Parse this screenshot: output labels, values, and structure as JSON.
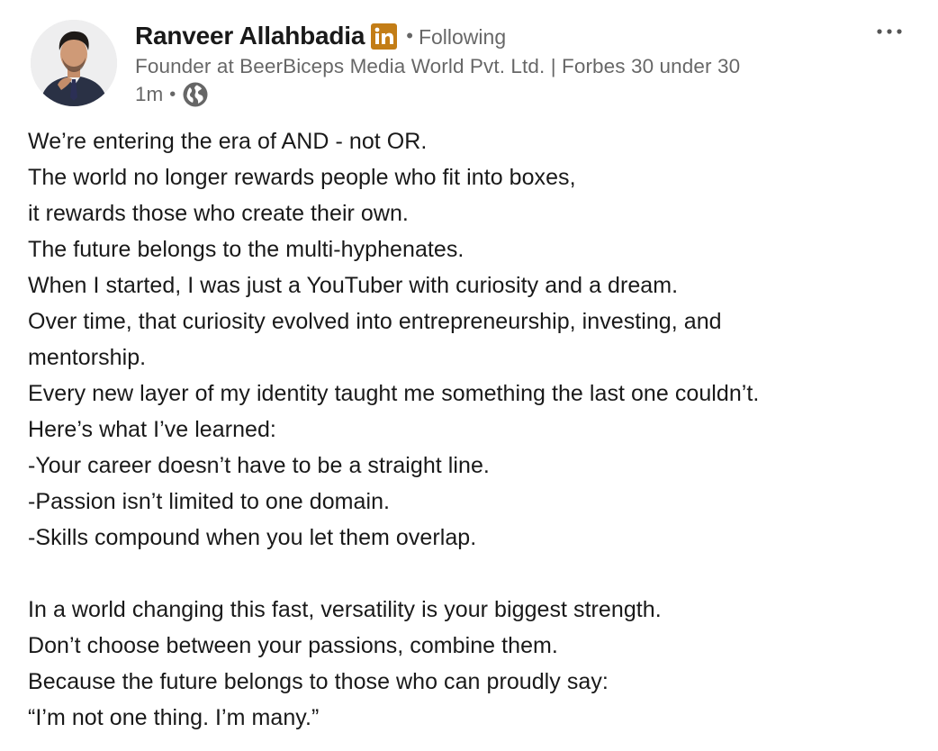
{
  "author": {
    "name": "Ranveer Allahbadia",
    "follow_status": "Following",
    "headline": "Founder at BeerBiceps Media World Pvt. Ltd. | Forbes 30 under 30",
    "time": "1m",
    "badge_icon": "linkedin-premium-icon",
    "visibility_icon": "globe-icon"
  },
  "colors": {
    "badge": "#C37D16",
    "text_primary": "#1f1f1f",
    "text_secondary": "#666666"
  },
  "separator": "•",
  "more_icon": "ellipsis-icon",
  "post": {
    "lines": [
      "We’re entering the era of AND - not OR.",
      "The world no longer rewards people who fit into boxes,",
      "it rewards those who create their own.",
      "The future belongs to the multi-hyphenates.",
      "When I started, I was just a YouTuber with curiosity and a dream.",
      "Over time, that curiosity evolved into entrepreneurship, investing, and",
      "mentorship.",
      "Every new layer of my identity taught me something the last one couldn’t.",
      "Here’s what I’ve learned:",
      "-Your career doesn’t have to be a straight line.",
      "-Passion isn’t limited to one domain.",
      "-Skills compound when you let them overlap.",
      "",
      "In a world changing this fast, versatility is your biggest strength.",
      "Don’t choose between your passions, combine them.",
      "Because the future belongs to those who can proudly say:",
      "“I’m not one thing. I’m many.”"
    ]
  }
}
